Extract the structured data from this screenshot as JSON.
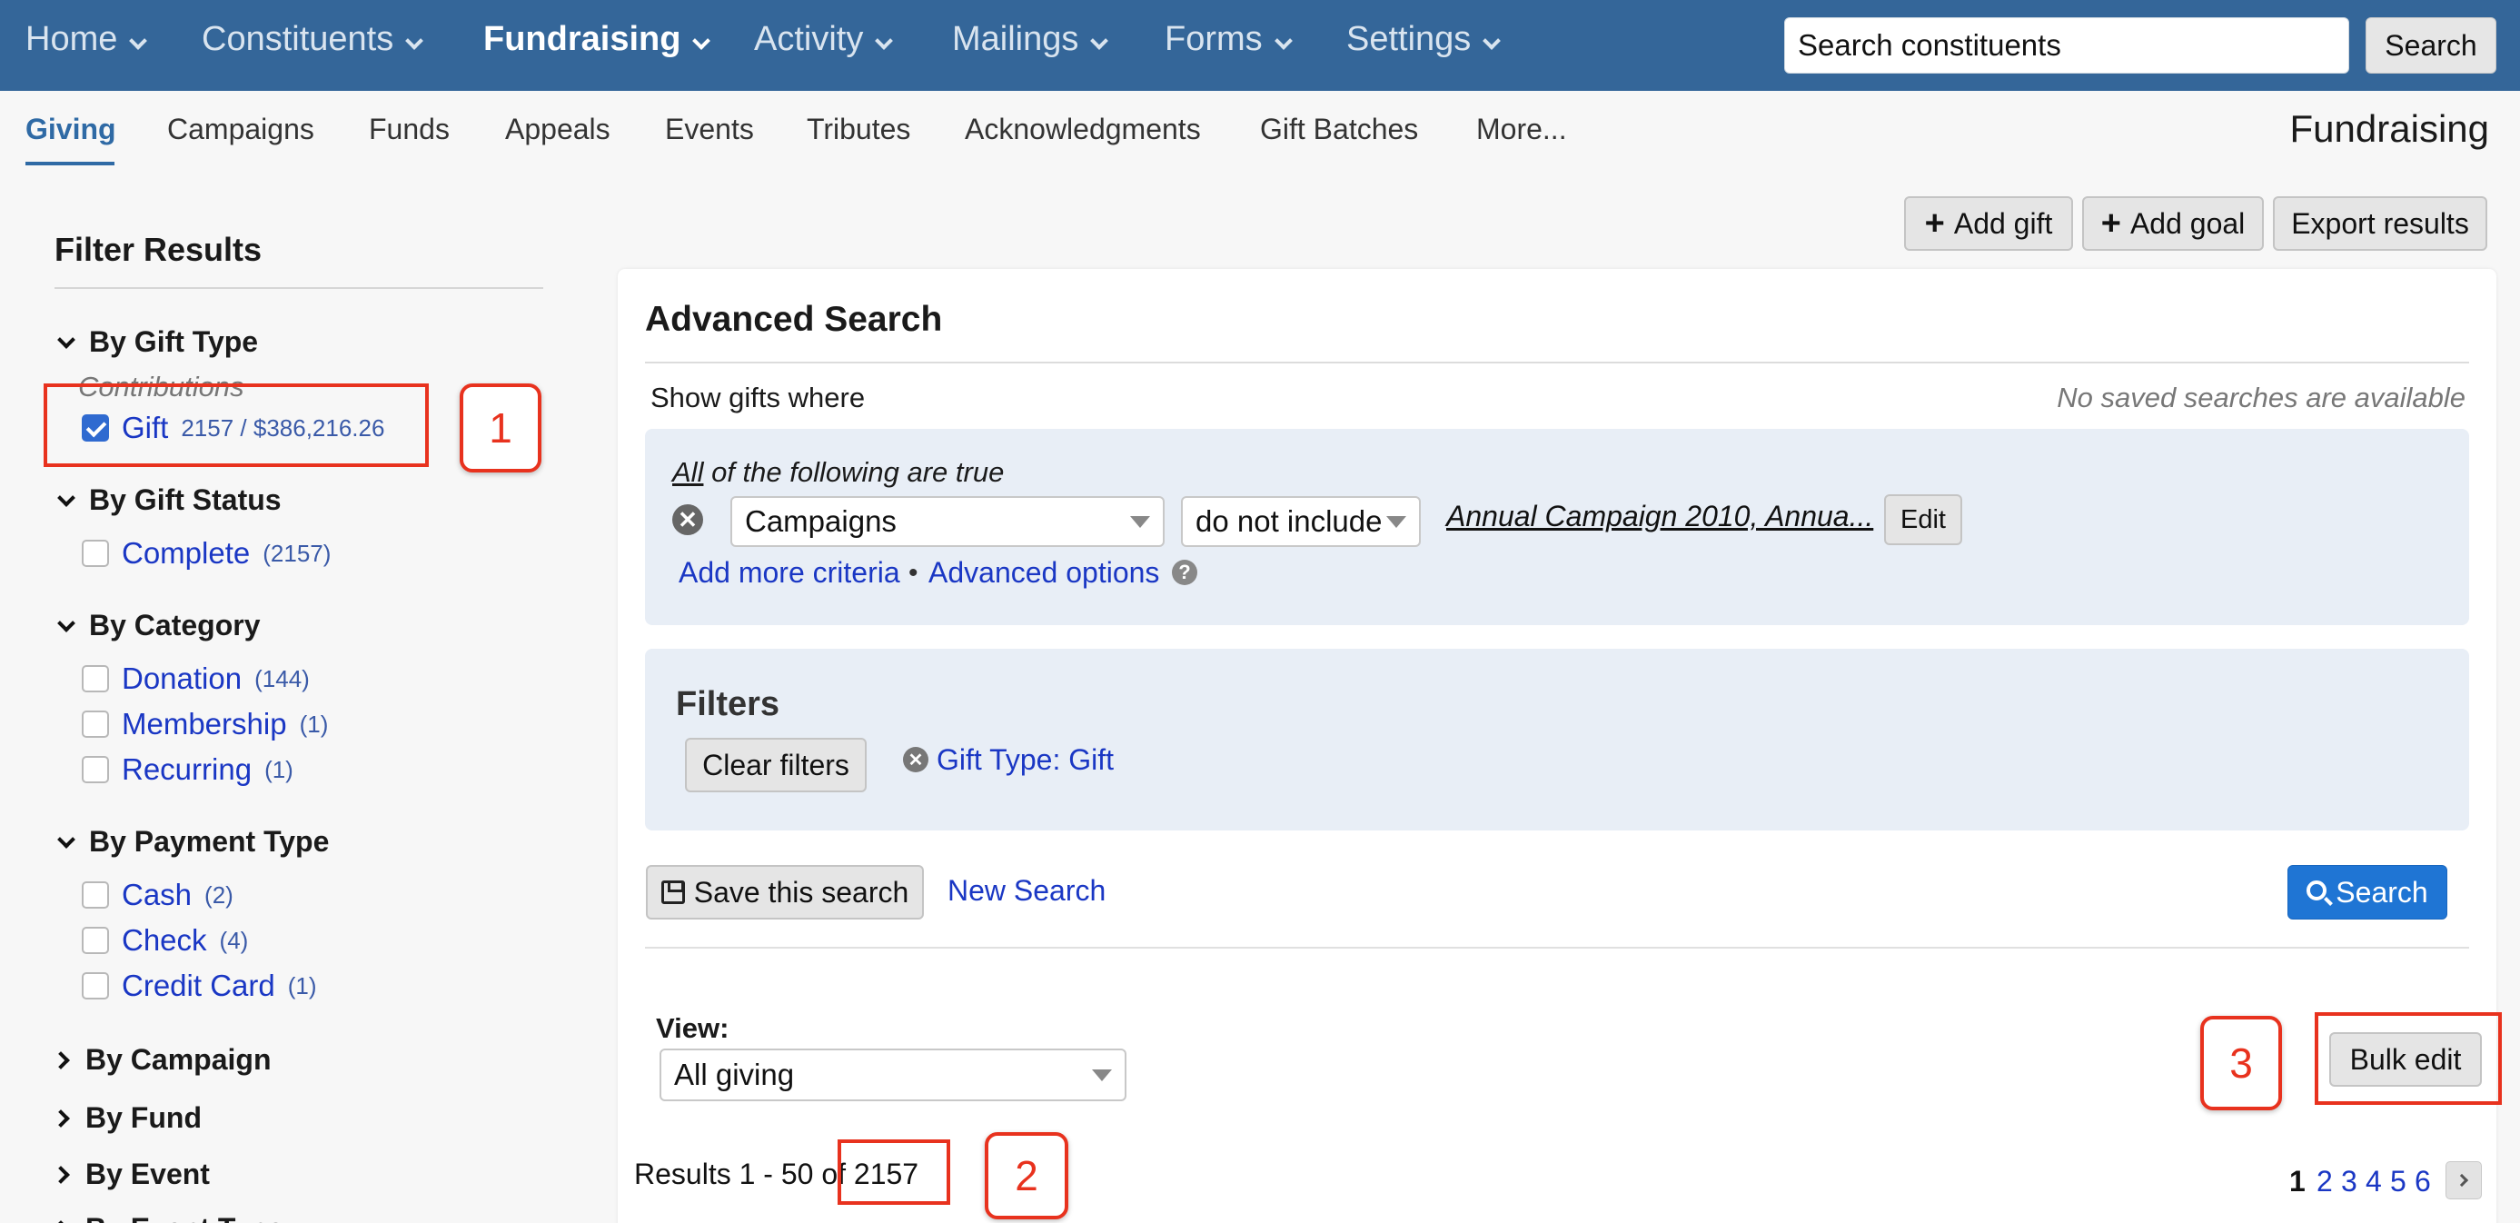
{
  "topnav": {
    "items": [
      {
        "label": "Home",
        "active": false
      },
      {
        "label": "Constituents",
        "active": false
      },
      {
        "label": "Fundraising",
        "active": true
      },
      {
        "label": "Activity",
        "active": false
      },
      {
        "label": "Mailings",
        "active": false
      },
      {
        "label": "Forms",
        "active": false
      },
      {
        "label": "Settings",
        "active": false
      }
    ],
    "search_value": "Search constituents",
    "search_button": "Search"
  },
  "subnav": {
    "items": [
      "Giving",
      "Campaigns",
      "Funds",
      "Appeals",
      "Events",
      "Tributes",
      "Acknowledgments",
      "Gift Batches",
      "More..."
    ],
    "active": "Giving",
    "page_heading": "Fundraising"
  },
  "actions": {
    "add_gift": "Add gift",
    "add_goal": "Add goal",
    "export_results": "Export results"
  },
  "sidebar": {
    "title": "Filter Results",
    "gift_type": {
      "heading": "By Gift Type",
      "subgroup": "Contributions",
      "items": [
        {
          "label": "Gift",
          "count": "2157 / $386,216.26",
          "checked": true
        }
      ]
    },
    "gift_status": {
      "heading": "By Gift Status",
      "items": [
        {
          "label": "Complete",
          "count": "(2157)",
          "checked": false
        }
      ]
    },
    "category": {
      "heading": "By Category",
      "items": [
        {
          "label": "Donation",
          "count": "(144)",
          "checked": false
        },
        {
          "label": "Membership",
          "count": "(1)",
          "checked": false
        },
        {
          "label": "Recurring",
          "count": "(1)",
          "checked": false
        }
      ]
    },
    "payment_type": {
      "heading": "By Payment Type",
      "items": [
        {
          "label": "Cash",
          "count": "(2)",
          "checked": false
        },
        {
          "label": "Check",
          "count": "(4)",
          "checked": false
        },
        {
          "label": "Credit Card",
          "count": "(1)",
          "checked": false
        }
      ]
    },
    "collapsed_sections": [
      "By Campaign",
      "By Fund",
      "By Event",
      "By Event Type"
    ]
  },
  "annotations": [
    "1",
    "2",
    "3"
  ],
  "advanced_search": {
    "title": "Advanced Search",
    "show_gifts_where": "Show gifts where",
    "no_saved": "No saved searches are available",
    "all_word": "All",
    "following_text": " of the following are true",
    "criteria": {
      "field": "Campaigns",
      "operator": "do not include",
      "value": "Annual Campaign 2010, Annua...",
      "edit_label": "Edit"
    },
    "add_more_criteria": "Add more criteria",
    "separator": "•",
    "advanced_options": "Advanced options",
    "filters": {
      "title": "Filters",
      "clear_label": "Clear filters",
      "chip": "Gift Type: Gift"
    },
    "save_search": "Save this search",
    "new_search": "New Search",
    "search_button": "Search"
  },
  "results": {
    "view_label": "View:",
    "view_value": "All giving",
    "bulk_edit": "Bulk edit",
    "summary_prefix": "Results 1 - 50 of ",
    "total": "2157",
    "pages": [
      "1",
      "2",
      "3",
      "4",
      "5",
      "6"
    ],
    "current_page": "1"
  },
  "colors": {
    "nav_bg": "#346699",
    "accent_blue": "#1f75d4",
    "link": "#1a37c4",
    "annotation_red": "#e8321e"
  },
  "icons": [
    "chevron-down-icon",
    "chevron-right-icon",
    "plus-icon",
    "remove-icon",
    "help-icon",
    "save-icon",
    "search-icon",
    "next-page-icon"
  ]
}
